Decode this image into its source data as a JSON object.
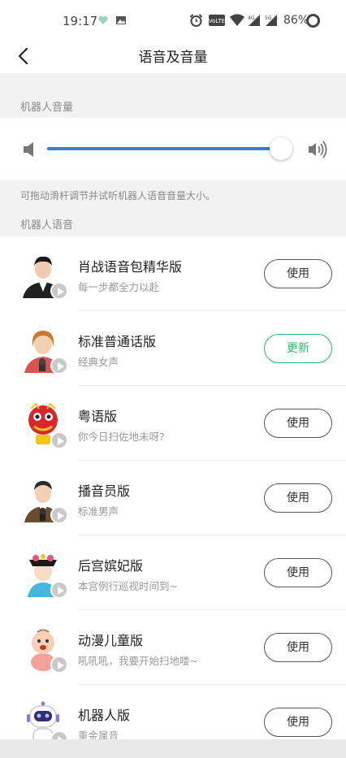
{
  "status": {
    "time": "19:17",
    "battery": "86%",
    "icons": [
      "heart-icon",
      "image-icon",
      "alarm-icon",
      "volte-icon",
      "wifi-icon",
      "signal-4g-icon",
      "signal-5g-icon",
      "battery-icon"
    ]
  },
  "header": {
    "title": "语音及音量",
    "back_icon": "chevron-left-icon"
  },
  "volume": {
    "section_label": "机器人音量",
    "level": 0.96,
    "accent_color": "#3a7bd5",
    "hint": "可拖动滑杆调节并试听机器人语音音量大小。"
  },
  "voices": {
    "section_label": "机器人语音",
    "items": [
      {
        "title": "肖战语音包精华版",
        "subtitle": "每一步都全力以赴",
        "action": "使用",
        "avatar": "young-man-suit-avatar"
      },
      {
        "title": "标准普通话版",
        "subtitle": "经典女声",
        "action": "更新",
        "avatar": "female-anchor-avatar",
        "action_color": "#2fb46b"
      },
      {
        "title": "粤语版",
        "subtitle": "你今日扫佐地未呀?",
        "action": "使用",
        "avatar": "lion-dance-avatar"
      },
      {
        "title": "播音员版",
        "subtitle": "标准男声",
        "action": "使用",
        "avatar": "male-anchor-avatar"
      },
      {
        "title": "后宫嫔妃版",
        "subtitle": "本宫例行巡视时间到~",
        "action": "使用",
        "avatar": "consort-avatar"
      },
      {
        "title": "动漫儿童版",
        "subtitle": "吼吼吼，我要开始扫地喽~",
        "action": "使用",
        "avatar": "baby-avatar"
      },
      {
        "title": "机器人版",
        "subtitle": "重金属音",
        "action": "使用",
        "avatar": "robot-avatar"
      }
    ]
  }
}
